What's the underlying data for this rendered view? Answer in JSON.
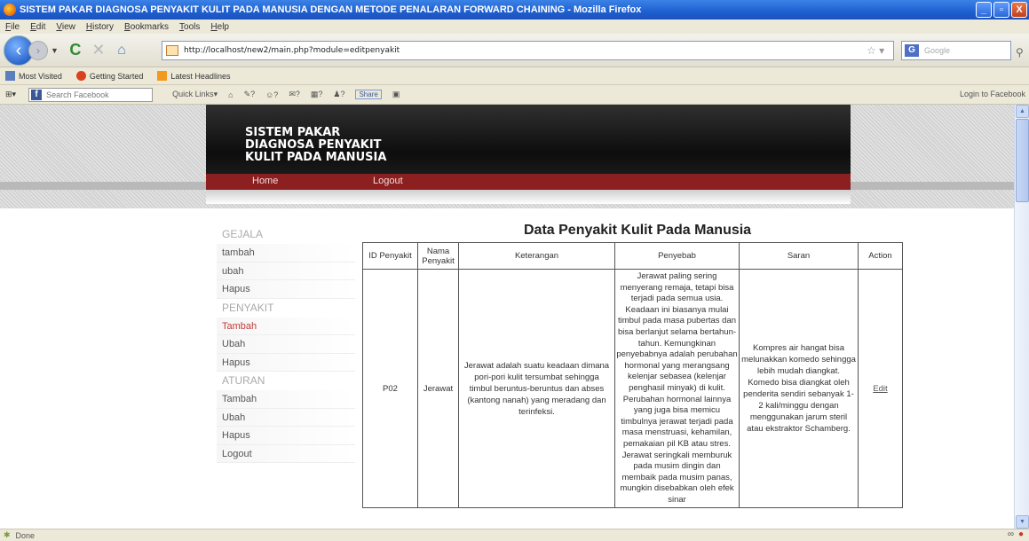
{
  "window": {
    "title": "SISTEM PAKAR DIAGNOSA PENYAKIT KULIT PADA MANUSIA DENGAN METODE PENALARAN FORWARD CHAINING - Mozilla Firefox",
    "controls": [
      "_",
      "▫",
      "X"
    ]
  },
  "menubar": [
    "File",
    "Edit",
    "View",
    "History",
    "Bookmarks",
    "Tools",
    "Help"
  ],
  "address": {
    "url": "http://localhost/new2/main.php?module=editpenyakit",
    "search_placeholder": "Google"
  },
  "bookmarks": [
    "Most Visited",
    "Getting Started",
    "Latest Headlines"
  ],
  "fbbar": {
    "search_placeholder": "Search Facebook",
    "quick_links": "Quick Links",
    "share": "Share",
    "login": "Login to Facebook"
  },
  "site": {
    "title_lines": [
      "SISTEM PAKAR",
      "DIAGNOSA PENYAKIT",
      "KULIT PADA MANUSIA"
    ],
    "nav": [
      "Home",
      "Logout"
    ]
  },
  "sidebar": [
    {
      "type": "head",
      "label": "GEJALA"
    },
    {
      "type": "item",
      "label": "tambah"
    },
    {
      "type": "item",
      "label": "ubah"
    },
    {
      "type": "item",
      "label": "Hapus"
    },
    {
      "type": "head",
      "label": "PENYAKIT"
    },
    {
      "type": "item",
      "label": "Tambah",
      "active": true
    },
    {
      "type": "item",
      "label": "Ubah"
    },
    {
      "type": "item",
      "label": "Hapus"
    },
    {
      "type": "head",
      "label": "ATURAN"
    },
    {
      "type": "item",
      "label": "Tambah"
    },
    {
      "type": "item",
      "label": "Ubah"
    },
    {
      "type": "item",
      "label": "Hapus"
    },
    {
      "type": "item",
      "label": "Logout"
    }
  ],
  "main": {
    "title": "Data Penyakit Kulit Pada Manusia",
    "columns": [
      "ID Penyakit",
      "Nama Penyakit",
      "Keterangan",
      "Penyebab",
      "Saran",
      "Action"
    ],
    "rows": [
      {
        "id": "P02",
        "nama": "Jerawat",
        "keterangan": "Jerawat adalah suatu keadaan dimana pori-pori kulit tersumbat sehingga timbul beruntus-beruntus dan abses (kantong nanah) yang meradang dan terinfeksi.",
        "penyebab": "Jerawat paling sering menyerang remaja, tetapi bisa terjadi pada semua usia. Keadaan ini biasanya mulai timbul pada masa pubertas dan bisa berlanjut selama bertahun-tahun. Kemungkinan penyebabnya adalah perubahan hormonal yang merangsang kelenjar sebasea (kelenjar penghasil minyak) di kulit. Perubahan hormonal lainnya yang juga bisa memicu timbulnya jerawat terjadi pada masa menstruasi, kehamilan, pemakaian pil KB atau stres. Jerawat seringkali memburuk pada musim dingin dan membaik pada musim panas, mungkin disebabkan oleh efek sinar",
        "saran": "Kompres air hangat bisa melunakkan komedo sehingga lebih mudah diangkat. Komedo bisa diangkat oleh penderita sendiri sebanyak 1-2 kali/minggu dengan menggunakan jarum steril atau ekstraktor Schamberg.",
        "action": "Edit"
      }
    ]
  },
  "status": {
    "text": "Done"
  }
}
